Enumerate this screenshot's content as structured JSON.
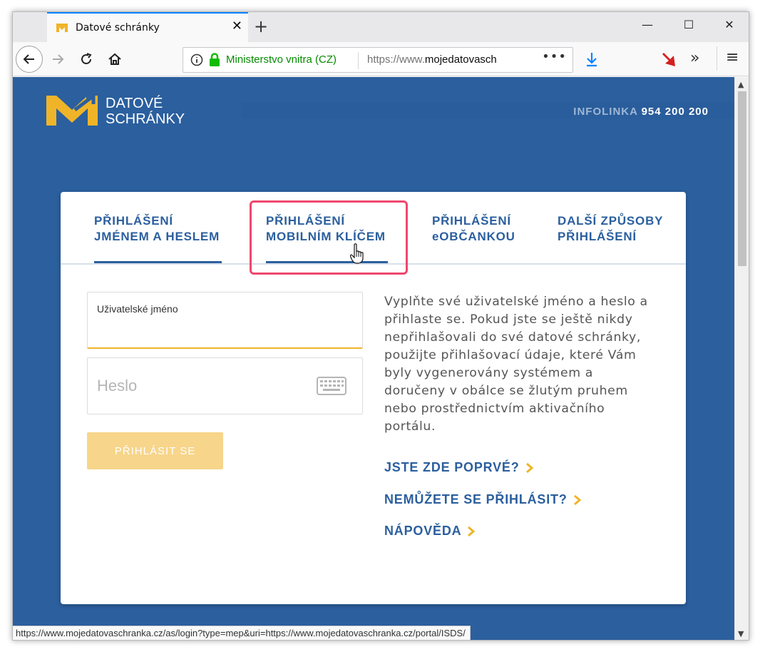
{
  "browser": {
    "tab_title": "Datové schránky",
    "url_org": "Ministerstvo vnitra (CZ)",
    "url_prefix": "https://www.",
    "url_domain": "mojedatovasch",
    "url_more": "•••",
    "status_url": "https://www.mojedatovaschranka.cz/as/login?type=mep&uri=https://www.mojedatovaschranka.cz/portal/ISDS/"
  },
  "header": {
    "logo_line1": "DATOVÉ",
    "logo_line2": "SCHRÁNKY",
    "info_label": "INFOLINKA",
    "info_number": "954 200 200"
  },
  "tabs": [
    {
      "line1": "PŘIHLÁŠENÍ",
      "line2": "JMÉNEM A HESLEM"
    },
    {
      "line1": "PŘIHLÁŠENÍ",
      "line2": "MOBILNÍM KLÍČEM"
    },
    {
      "line1": "PŘIHLÁŠENÍ",
      "line2": "eOBČANKOU"
    },
    {
      "line1": "DALŠÍ ZPŮSOBY",
      "line2": "PŘIHLÁŠENÍ"
    }
  ],
  "form": {
    "username_label": "Uživatelské jméno",
    "password_placeholder": "Heslo",
    "submit_label": "PŘIHLÁSIT SE"
  },
  "description": "Vyplňte své uživatelské jméno a heslo a přihlaste se. Pokud jste se ještě nikdy nepřihlašovali do své datové schránky, použijte přihlašovací údaje, které Vám byly vygenerovány systémem a doručeny v obálce se žlutým pruhem nebo prostřednictvím aktivačního portálu.",
  "links": {
    "first_time": "JSTE ZDE POPRVÉ?",
    "cannot_login": "NEMŮŽETE SE PŘIHLÁSIT?",
    "help": "NÁPOVĚDA"
  },
  "colors": {
    "page_bg": "#2b5f9e",
    "accent_yellow": "#f0b429",
    "highlight": "#f0476e"
  }
}
